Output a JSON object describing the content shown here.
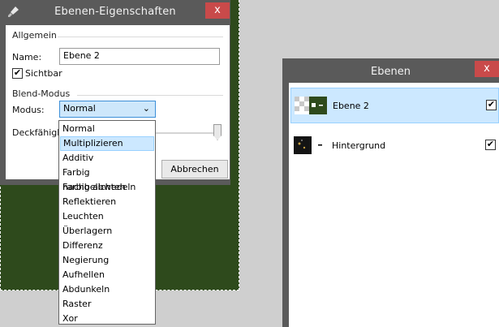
{
  "dialog": {
    "title": "Ebenen-Eigenschaften",
    "close_label": "x",
    "general_section": "Allgemein",
    "name_label": "Name:",
    "name_value": "Ebene 2",
    "visible_label": "Sichtbar",
    "visible_checked": "✔",
    "blend_section": "Blend-Modus",
    "mode_label": "Modus:",
    "mode_value": "Normal",
    "opacity_label": "Deckfähigk",
    "cancel_button": "Abbrechen"
  },
  "blend_modes": {
    "options": [
      "Normal",
      "Multiplizieren",
      "Additiv",
      "Farbig nachbelichten",
      "Farbig abwedeln",
      "Reflektieren",
      "Leuchten",
      "Überlagern",
      "Differenz",
      "Negierung",
      "Aufhellen",
      "Abdunkeln",
      "Raster",
      "Xor"
    ],
    "hovered": "Multiplizieren"
  },
  "layers_panel": {
    "title": "Ebenen",
    "close_label": "x",
    "layers": [
      {
        "name": "Ebene 2",
        "visible": "✔",
        "selected": true
      },
      {
        "name": "Hintergrund",
        "visible": "✔",
        "selected": false
      }
    ]
  },
  "colors": {
    "window_frame": "#5a5a5a",
    "close_red": "#c94a4a",
    "selection_blue": "#cce8ff",
    "canvas_green": "#2e4a1c"
  }
}
